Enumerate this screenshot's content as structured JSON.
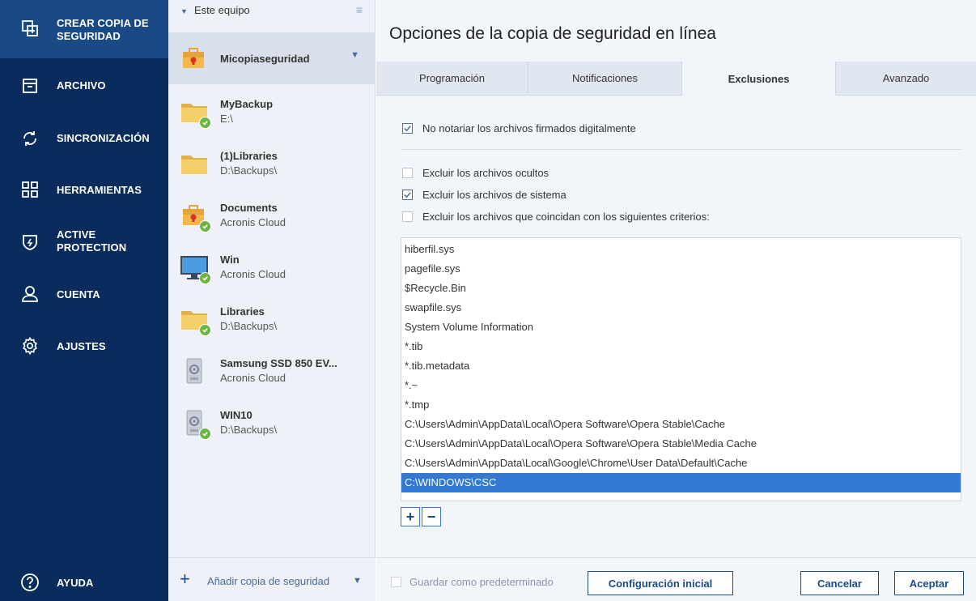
{
  "sidebar": {
    "items": [
      {
        "label": "CREAR COPIA DE\nSEGURIDAD",
        "icon": "copy-icon"
      },
      {
        "label": "ARCHIVO",
        "icon": "archive-icon"
      },
      {
        "label": "SINCRONIZACIÓN",
        "icon": "sync-icon"
      },
      {
        "label": "HERRAMIENTAS",
        "icon": "grid-icon"
      },
      {
        "label": "ACTIVE\nPROTECTION",
        "icon": "shield-icon"
      },
      {
        "label": "CUENTA",
        "icon": "user-icon"
      },
      {
        "label": "AJUSTES",
        "icon": "gear-icon"
      }
    ],
    "help": {
      "label": "AYUDA",
      "icon": "help-icon"
    }
  },
  "backup_list": {
    "header": "Este equipo",
    "items": [
      {
        "name": "Micopiaseguridad",
        "sub": "",
        "icon": "briefcase-icon"
      },
      {
        "name": "MyBackup",
        "sub": "E:\\",
        "icon": "folder-icon"
      },
      {
        "name": "(1)Libraries",
        "sub": "D:\\Backups\\",
        "icon": "folder-icon"
      },
      {
        "name": "Documents",
        "sub": "Acronis Cloud",
        "icon": "briefcase-icon"
      },
      {
        "name": "Win",
        "sub": "Acronis Cloud",
        "icon": "monitor-icon"
      },
      {
        "name": "Libraries",
        "sub": "D:\\Backups\\",
        "icon": "folder-icon"
      },
      {
        "name": "Samsung SSD 850 EV...",
        "sub": "Acronis Cloud",
        "icon": "disk-icon"
      },
      {
        "name": "WIN10",
        "sub": "D:\\Backups\\",
        "icon": "disk-icon"
      }
    ],
    "add_label": "Añadir copia de seguridad"
  },
  "main": {
    "title": "Opciones de la copia de seguridad en línea",
    "tabs": [
      "Programación",
      "Notificaciones",
      "Exclusiones",
      "Avanzado"
    ],
    "active_tab": "Exclusiones",
    "options": {
      "no_notarize": {
        "label": "No notariar los archivos firmados digitalmente",
        "checked": true
      },
      "exclude_hidden": {
        "label": "Excluir los archivos ocultos",
        "checked": false
      },
      "exclude_system": {
        "label": "Excluir los archivos de sistema",
        "checked": true
      },
      "exclude_criteria": {
        "label": "Excluir los archivos que coincidan con los siguientes criterios:",
        "checked": false
      }
    },
    "exclusions": [
      "hiberfil.sys",
      "pagefile.sys",
      "$Recycle.Bin",
      "swapfile.sys",
      "System Volume Information",
      "*.tib",
      "*.tib.metadata",
      "*.~",
      "*.tmp",
      "C:\\Users\\Admin\\AppData\\Local\\Opera Software\\Opera Stable\\Cache",
      "C:\\Users\\Admin\\AppData\\Local\\Opera Software\\Opera Stable\\Media Cache",
      "C:\\Users\\Admin\\AppData\\Local\\Google\\Chrome\\User Data\\Default\\Cache",
      "C:\\WINDOWS\\CSC"
    ],
    "selected_exclusion": "C:\\WINDOWS\\CSC",
    "add_symbol": "+",
    "remove_symbol": "−"
  },
  "footer": {
    "save_default": "Guardar como predeterminado",
    "initial_config": "Configuración inicial",
    "cancel": "Cancelar",
    "accept": "Aceptar"
  },
  "colors": {
    "sidebar_bg": "#0a2c5c",
    "sidebar_active": "#1a4a86",
    "accent": "#3378d1",
    "success": "#6db33f"
  }
}
